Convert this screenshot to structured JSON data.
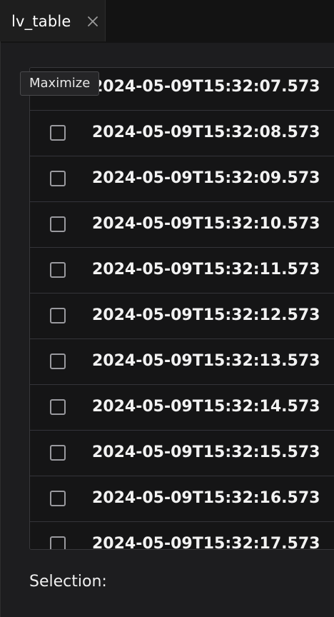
{
  "tab": {
    "label": "lv_table",
    "close_icon": "close-icon"
  },
  "tooltip": {
    "text": "Maximize"
  },
  "list": {
    "rows": [
      {
        "text": "2024-05-09T15:32:07.573",
        "checked": false
      },
      {
        "text": "2024-05-09T15:32:08.573",
        "checked": false
      },
      {
        "text": "2024-05-09T15:32:09.573",
        "checked": false
      },
      {
        "text": "2024-05-09T15:32:10.573",
        "checked": false
      },
      {
        "text": "2024-05-09T15:32:11.573",
        "checked": false
      },
      {
        "text": "2024-05-09T15:32:12.573",
        "checked": false
      },
      {
        "text": "2024-05-09T15:32:13.573",
        "checked": false
      },
      {
        "text": "2024-05-09T15:32:14.573",
        "checked": false
      },
      {
        "text": "2024-05-09T15:32:15.573",
        "checked": false
      },
      {
        "text": "2024-05-09T15:32:16.573",
        "checked": false
      },
      {
        "text": "2024-05-09T15:32:17.573",
        "checked": false
      }
    ]
  },
  "footer": {
    "selection_label": "Selection:"
  },
  "colors": {
    "background": "#1d1d1f",
    "row_background": "#151516",
    "text": "#f2f2f2",
    "checkbox_border": "#9a9a9f"
  }
}
